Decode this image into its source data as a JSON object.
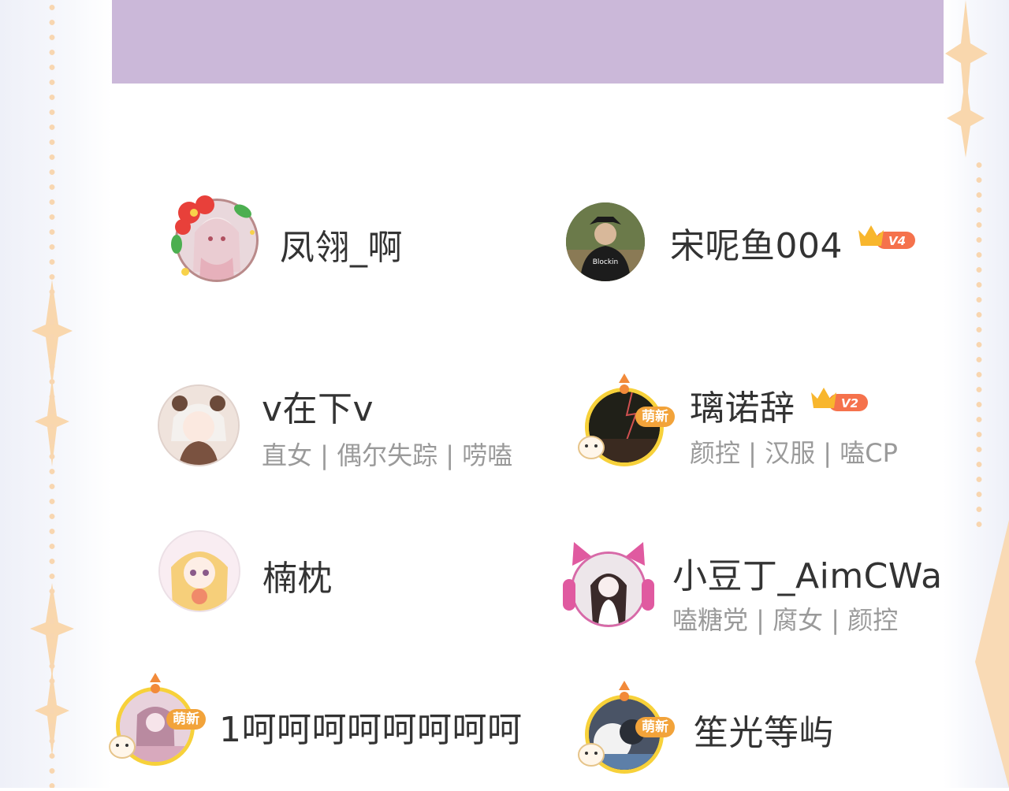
{
  "users": [
    {
      "name": "凤翎_啊",
      "tags": ""
    },
    {
      "name": "宋呢鱼004",
      "tags": "",
      "vip": "V4"
    },
    {
      "name": "v在下v",
      "tags": "直女 | 偶尔失踪 | 唠嗑"
    },
    {
      "name": "璃诺辞",
      "tags": "颜控 | 汉服 | 嗑CP",
      "vip": "V2",
      "badge": "萌新"
    },
    {
      "name": "楠枕",
      "tags": ""
    },
    {
      "name": "小豆丁_AimCWa",
      "tags": "嗑糖党 | 腐女 | 颜控"
    },
    {
      "name": "1呵呵呵呵呵呵呵呵",
      "tags": "",
      "badge": "萌新"
    },
    {
      "name": "笙光等屿",
      "tags": "",
      "badge": "萌新"
    }
  ],
  "colors": {
    "banner": "#cbb8d9",
    "name": "#333333",
    "tags": "#9a9a9a",
    "vip": "#f5724c",
    "crown": "#f8b62d"
  }
}
